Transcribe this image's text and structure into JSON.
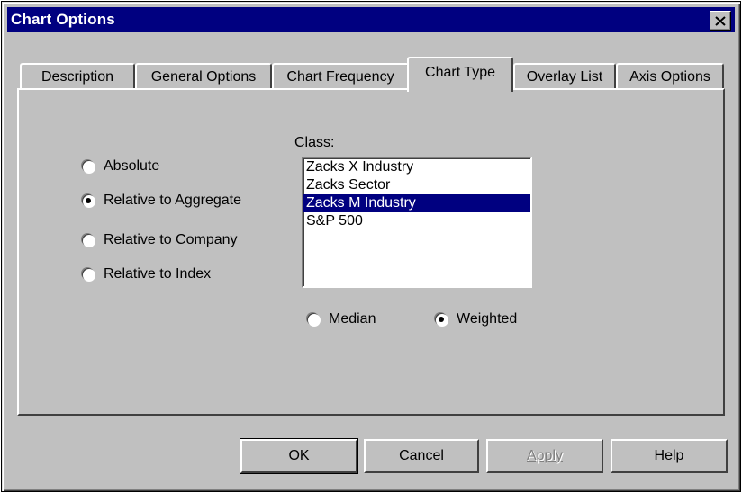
{
  "window": {
    "title": "Chart Options"
  },
  "tabs": [
    {
      "label": "Description"
    },
    {
      "label": "General Options"
    },
    {
      "label": "Chart Frequency"
    },
    {
      "label": "Chart Type"
    },
    {
      "label": "Overlay List"
    },
    {
      "label": "Axis Options"
    }
  ],
  "active_tab": "Chart Type",
  "chart_type_options": [
    {
      "label": "Absolute",
      "checked": false
    },
    {
      "label": "Relative to Aggregate",
      "checked": true
    },
    {
      "label": "Relative to Company",
      "checked": false
    },
    {
      "label": "Relative to Index",
      "checked": false
    }
  ],
  "class": {
    "label": "Class:",
    "items": [
      "Zacks X Industry",
      "Zacks Sector",
      "Zacks M Industry",
      "S&P 500"
    ],
    "selected": "Zacks M Industry"
  },
  "aggregation": [
    {
      "label": "Median",
      "checked": false
    },
    {
      "label": "Weighted",
      "checked": true
    }
  ],
  "buttons": {
    "ok": "OK",
    "cancel": "Cancel",
    "apply": "Apply",
    "help": "Help"
  },
  "icons": {
    "close": "close-icon"
  }
}
